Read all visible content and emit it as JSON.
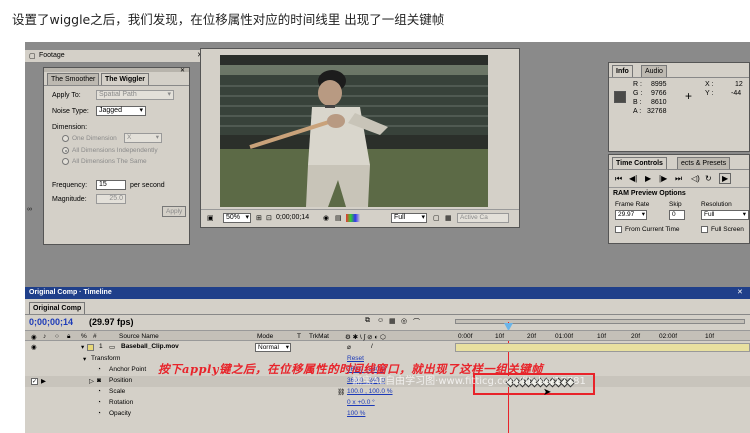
{
  "caption": "设置了wiggle之后，我们发现，在位移属性对应的时间线里 出现了一组关键帧",
  "footage": {
    "label": "Footage"
  },
  "wiggler": {
    "tabs": [
      "The Smoother",
      "The Wiggler"
    ],
    "apply_to_label": "Apply To:",
    "apply_to_value": "Spatial Path",
    "noise_type_label": "Noise Type:",
    "noise_type_value": "Jagged",
    "dimension_label": "Dimension:",
    "one_dimension": "One Dimension",
    "one_dimension_value": "X",
    "all_independent": "All Dimensions Independently",
    "all_same": "All Dimensions The Same",
    "frequency_label": "Frequency:",
    "frequency_value": "15",
    "frequency_unit": "per second",
    "magnitude_label": "Magnitude:",
    "magnitude_value": "25.0",
    "apply_button": "Apply"
  },
  "viewer": {
    "zoom": "50%",
    "timecode": "0;00;00;14",
    "resolution": "Full",
    "active_camera": "Active Ca"
  },
  "info": {
    "tabs": [
      "Info",
      "Audio"
    ],
    "r_label": "R :",
    "r_value": "8995",
    "g_label": "G :",
    "g_value": "9766",
    "b_label": "B :",
    "b_value": "8610",
    "a_label": "A :",
    "a_value": "32768",
    "x_label": "X :",
    "x_value": "12",
    "y_label": "Y :",
    "y_value": "-44",
    "swatch_color": "#4a4a48"
  },
  "time_controls": {
    "tabs": [
      "Time Controls",
      "ects & Presets"
    ],
    "ram_preview": "RAM Preview Options",
    "frame_rate_label": "Frame Rate",
    "frame_rate_value": "29.97",
    "skip_label": "Skip",
    "skip_value": "0",
    "resolution_label": "Resolution",
    "resolution_value": "Full",
    "from_current_time": "From Current Time",
    "full_screen": "Full Screen"
  },
  "timeline": {
    "title": "Original Comp · Timeline",
    "tab": "Original Comp",
    "timecode": "0;00;00;14",
    "fps": "(29.97 fps)",
    "col_source": "Source Name",
    "col_mode": "Mode",
    "col_t": "T",
    "col_trkmat": "TrkMat",
    "ruler": [
      "0:00f",
      "10f",
      "20f",
      "01:00f",
      "10f",
      "20f",
      "02:00f",
      "10f"
    ],
    "layer_index": "1",
    "layer_name": "Baseball_Clip.mov",
    "layer_mode": "Normal",
    "transform": "Transform",
    "reset": "Reset",
    "props": [
      {
        "name": "Anchor Point",
        "value": "360.0 , 240.0"
      },
      {
        "name": "Position",
        "value": "360.0 , 240.0"
      },
      {
        "name": "Scale",
        "value": "100.0 , 100.0 %"
      },
      {
        "name": "Rotation",
        "value": "0 x +0.0 °"
      },
      {
        "name": "Opacity",
        "value": "100 %"
      }
    ]
  },
  "annotation": "按下apply键之后，在位移属性的时间线窗口，就出现了这样一组关键帧",
  "watermark": "翻宝AE自由学习图·www.fitticg.com/fitebo/17781",
  "colors": {
    "accent_red": "#e8232a",
    "title_blue": "#1f3f8a",
    "panel": "#d4d0c8"
  }
}
